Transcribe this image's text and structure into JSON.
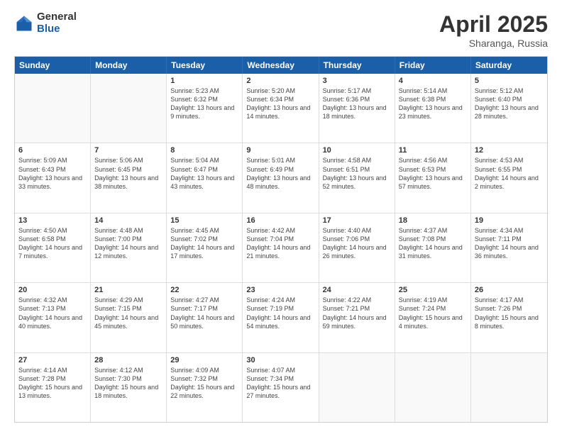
{
  "header": {
    "logo_general": "General",
    "logo_blue": "Blue",
    "title": "April 2025",
    "location": "Sharanga, Russia"
  },
  "days_of_week": [
    "Sunday",
    "Monday",
    "Tuesday",
    "Wednesday",
    "Thursday",
    "Friday",
    "Saturday"
  ],
  "weeks": [
    [
      {
        "day": "",
        "info": ""
      },
      {
        "day": "",
        "info": ""
      },
      {
        "day": "1",
        "info": "Sunrise: 5:23 AM\nSunset: 6:32 PM\nDaylight: 13 hours and 9 minutes."
      },
      {
        "day": "2",
        "info": "Sunrise: 5:20 AM\nSunset: 6:34 PM\nDaylight: 13 hours and 14 minutes."
      },
      {
        "day": "3",
        "info": "Sunrise: 5:17 AM\nSunset: 6:36 PM\nDaylight: 13 hours and 18 minutes."
      },
      {
        "day": "4",
        "info": "Sunrise: 5:14 AM\nSunset: 6:38 PM\nDaylight: 13 hours and 23 minutes."
      },
      {
        "day": "5",
        "info": "Sunrise: 5:12 AM\nSunset: 6:40 PM\nDaylight: 13 hours and 28 minutes."
      }
    ],
    [
      {
        "day": "6",
        "info": "Sunrise: 5:09 AM\nSunset: 6:43 PM\nDaylight: 13 hours and 33 minutes."
      },
      {
        "day": "7",
        "info": "Sunrise: 5:06 AM\nSunset: 6:45 PM\nDaylight: 13 hours and 38 minutes."
      },
      {
        "day": "8",
        "info": "Sunrise: 5:04 AM\nSunset: 6:47 PM\nDaylight: 13 hours and 43 minutes."
      },
      {
        "day": "9",
        "info": "Sunrise: 5:01 AM\nSunset: 6:49 PM\nDaylight: 13 hours and 48 minutes."
      },
      {
        "day": "10",
        "info": "Sunrise: 4:58 AM\nSunset: 6:51 PM\nDaylight: 13 hours and 52 minutes."
      },
      {
        "day": "11",
        "info": "Sunrise: 4:56 AM\nSunset: 6:53 PM\nDaylight: 13 hours and 57 minutes."
      },
      {
        "day": "12",
        "info": "Sunrise: 4:53 AM\nSunset: 6:55 PM\nDaylight: 14 hours and 2 minutes."
      }
    ],
    [
      {
        "day": "13",
        "info": "Sunrise: 4:50 AM\nSunset: 6:58 PM\nDaylight: 14 hours and 7 minutes."
      },
      {
        "day": "14",
        "info": "Sunrise: 4:48 AM\nSunset: 7:00 PM\nDaylight: 14 hours and 12 minutes."
      },
      {
        "day": "15",
        "info": "Sunrise: 4:45 AM\nSunset: 7:02 PM\nDaylight: 14 hours and 17 minutes."
      },
      {
        "day": "16",
        "info": "Sunrise: 4:42 AM\nSunset: 7:04 PM\nDaylight: 14 hours and 21 minutes."
      },
      {
        "day": "17",
        "info": "Sunrise: 4:40 AM\nSunset: 7:06 PM\nDaylight: 14 hours and 26 minutes."
      },
      {
        "day": "18",
        "info": "Sunrise: 4:37 AM\nSunset: 7:08 PM\nDaylight: 14 hours and 31 minutes."
      },
      {
        "day": "19",
        "info": "Sunrise: 4:34 AM\nSunset: 7:11 PM\nDaylight: 14 hours and 36 minutes."
      }
    ],
    [
      {
        "day": "20",
        "info": "Sunrise: 4:32 AM\nSunset: 7:13 PM\nDaylight: 14 hours and 40 minutes."
      },
      {
        "day": "21",
        "info": "Sunrise: 4:29 AM\nSunset: 7:15 PM\nDaylight: 14 hours and 45 minutes."
      },
      {
        "day": "22",
        "info": "Sunrise: 4:27 AM\nSunset: 7:17 PM\nDaylight: 14 hours and 50 minutes."
      },
      {
        "day": "23",
        "info": "Sunrise: 4:24 AM\nSunset: 7:19 PM\nDaylight: 14 hours and 54 minutes."
      },
      {
        "day": "24",
        "info": "Sunrise: 4:22 AM\nSunset: 7:21 PM\nDaylight: 14 hours and 59 minutes."
      },
      {
        "day": "25",
        "info": "Sunrise: 4:19 AM\nSunset: 7:24 PM\nDaylight: 15 hours and 4 minutes."
      },
      {
        "day": "26",
        "info": "Sunrise: 4:17 AM\nSunset: 7:26 PM\nDaylight: 15 hours and 8 minutes."
      }
    ],
    [
      {
        "day": "27",
        "info": "Sunrise: 4:14 AM\nSunset: 7:28 PM\nDaylight: 15 hours and 13 minutes."
      },
      {
        "day": "28",
        "info": "Sunrise: 4:12 AM\nSunset: 7:30 PM\nDaylight: 15 hours and 18 minutes."
      },
      {
        "day": "29",
        "info": "Sunrise: 4:09 AM\nSunset: 7:32 PM\nDaylight: 15 hours and 22 minutes."
      },
      {
        "day": "30",
        "info": "Sunrise: 4:07 AM\nSunset: 7:34 PM\nDaylight: 15 hours and 27 minutes."
      },
      {
        "day": "",
        "info": ""
      },
      {
        "day": "",
        "info": ""
      },
      {
        "day": "",
        "info": ""
      }
    ]
  ]
}
